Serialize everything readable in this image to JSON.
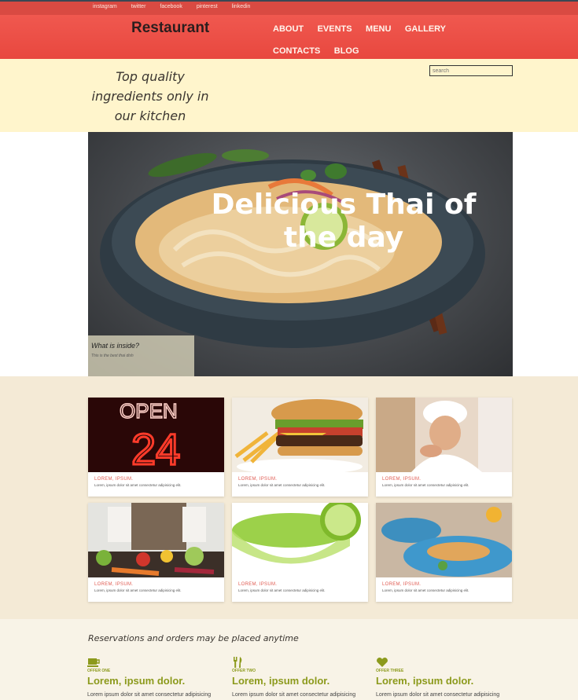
{
  "social": [
    "instagram",
    "twitter",
    "facebook",
    "pinterest",
    "linkedin"
  ],
  "brand": "Restaurant",
  "nav": [
    "ABOUT",
    "EVENTS",
    "MENU",
    "GALLERY",
    "CONTACTS",
    "BLOG"
  ],
  "tagline": "Top quality ingredients only in our kitchen",
  "search": {
    "placeholder": "search"
  },
  "hero": {
    "title": "Delicious Thai of the day",
    "caption_title": "What is inside?",
    "caption_sub": "This is the best thai dish"
  },
  "cards": [
    {
      "title": "LOREM, IPSUM.",
      "text": "Lorem, ipsum dolor sit amet consectetur adipisicing elit.",
      "image": "open-24-neon-sign"
    },
    {
      "title": "LOREM, IPSUM.",
      "text": "Lorem, ipsum dolor sit amet consectetur adipisicing elit.",
      "image": "burger-and-fries"
    },
    {
      "title": "LOREM, IPSUM.",
      "text": "Lorem, ipsum dolor sit amet consectetur adipisicing elit.",
      "image": "smiling-chef"
    },
    {
      "title": "LOREM, IPSUM.",
      "text": "Lorem, ipsum dolor sit amet consectetur adipisicing elit.",
      "image": "cook-with-vegetables"
    },
    {
      "title": "LOREM, IPSUM.",
      "text": "Lorem, ipsum dolor sit amet consectetur adipisicing elit.",
      "image": "green-drink-with-lime"
    },
    {
      "title": "LOREM, IPSUM.",
      "text": "Lorem, ipsum dolor sit amet consectetur adipisicing elit.",
      "image": "spring-rolls-plate"
    }
  ],
  "offers": {
    "intro": "Reservations and orders may be placed anytime",
    "items": [
      {
        "icon": "coffee-cup-icon",
        "kicker": "OFFER ONE",
        "heading": "Lorem, ipsum dolor.",
        "body": "Lorem ipsum dolor sit amet consectetur adipisicing"
      },
      {
        "icon": "fork-knife-icon",
        "kicker": "OFFER TWO",
        "heading": "Lorem, ipsum dolor.",
        "body": "Lorem ipsum dolor sit amet consectetur adipisicing"
      },
      {
        "icon": "heart-icon",
        "kicker": "OFFER THREE",
        "heading": "Lorem, ipsum dolor.",
        "body": "Lorem ipsum dolor sit amet consectetur adipisicing"
      }
    ]
  },
  "colors": {
    "header": "#e94b42",
    "cream": "#fff5cc",
    "offer_accent": "#8c9a1c",
    "card_title": "#e05b52"
  }
}
